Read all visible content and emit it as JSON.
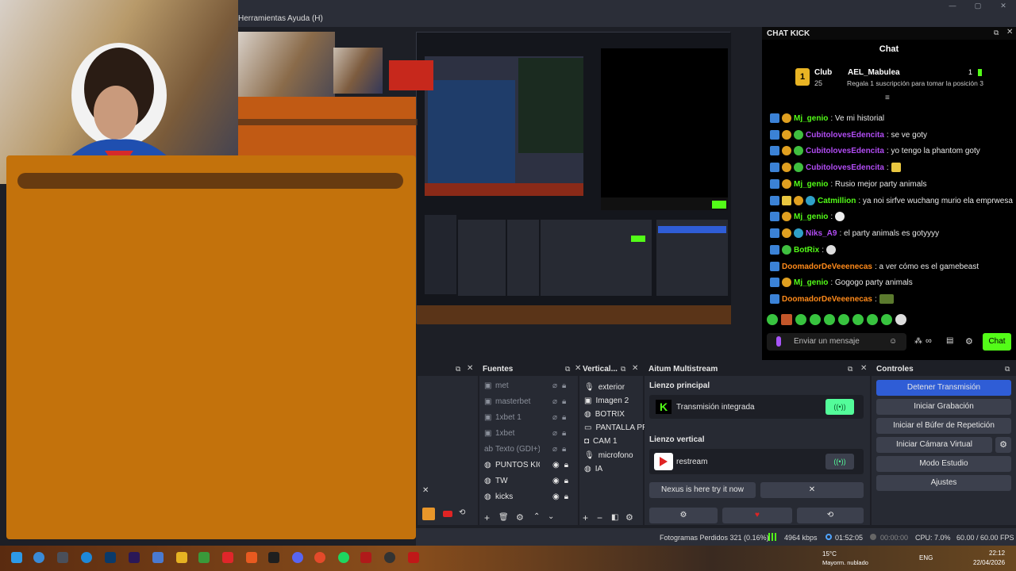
{
  "menu": {
    "herramientas": "Herramientas",
    "ayuda": "Ayuda (H)"
  },
  "window_controls": {
    "minimize": "—",
    "maximize": "▢",
    "close": "✕"
  },
  "chat": {
    "dock_title": "CHAT KICK",
    "header": "Chat",
    "club_label": "Club",
    "club_number": "25",
    "top_user": "AEL_Mabulea",
    "top_user_count": "1",
    "club_message": "Regala 1 suscripción para tomar la posición 3",
    "messages": [
      {
        "user": "Mj_genio",
        "text": "Ve mi historial",
        "color": "green"
      },
      {
        "user": "CubitolovesEdencita",
        "text": "se ve goty",
        "color": "purple"
      },
      {
        "user": "CubitolovesEdencita",
        "text": "yo tengo la phantom goty",
        "color": "purple"
      },
      {
        "user": "CubitolovesEdencita",
        "text": "",
        "color": "purple"
      },
      {
        "user": "Mj_genio",
        "text": "Rusio mejor party animals",
        "color": "green"
      },
      {
        "user": "Catmillion",
        "text": "ya noi sirfve wuchang murio ela emprwesa",
        "color": "green"
      },
      {
        "user": "Mj_genio",
        "text": "",
        "color": "green"
      },
      {
        "user": "Niks_A9",
        "text": "el party animals es gotyyyy",
        "color": "purple"
      },
      {
        "user": "BotRix",
        "text": "",
        "color": "green"
      },
      {
        "user": "DoomadorDeVeeenecas",
        "text": "a ver cómo es el gamebeast",
        "color": "orange"
      },
      {
        "user": "Mj_genio",
        "text": "Gogogo party animals",
        "color": "green"
      },
      {
        "user": "DoomadorDeVeeenecas",
        "text": "",
        "color": "orange"
      }
    ],
    "input_placeholder": "Enviar un mensaje",
    "send_label": "Chat"
  },
  "sources": {
    "title": "Fuentes",
    "items": [
      {
        "name": "met"
      },
      {
        "name": "masterbet"
      },
      {
        "name": "1xbet 1"
      },
      {
        "name": "1xbet"
      },
      {
        "name": "Texto (GDI+) 2"
      },
      {
        "name": "PUNTOS KICK"
      },
      {
        "name": "TW"
      },
      {
        "name": "kicks"
      }
    ]
  },
  "vertical": {
    "title": "Vertical...",
    "items": [
      {
        "name": "exterior"
      },
      {
        "name": "Imagen 2"
      },
      {
        "name": "BOTRIX"
      },
      {
        "name": "PANTALLA PR"
      },
      {
        "name": "CAM 1"
      },
      {
        "name": "microfono"
      },
      {
        "name": "IA"
      }
    ]
  },
  "multistream": {
    "title": "Aitum Multistream",
    "principal_label": "Lienzo principal",
    "principal_item": "Transmisión integrada",
    "vertical_label": "Lienzo vertical",
    "vertical_item": "restream",
    "nexus_label": "Nexus is here try it now"
  },
  "controls": {
    "title": "Controles",
    "buttons": [
      "Detener Transmisión",
      "Iniciar Grabación",
      "Iniciar el Búfer de Repetición",
      "Iniciar Cámara Virtual",
      "Modo Estudio",
      "Ajustes"
    ]
  },
  "status": {
    "dropped_frames": "Fotogramas Perdidos 321 (0.16%)",
    "bitrate": "4964 kbps",
    "stream_time": "01:52:05",
    "rec_time": "00:00:00",
    "cpu": "CPU: 7.0%",
    "fps": "60.00 / 60.00 FPS"
  },
  "taskbar": {
    "weather_temp": "15°C",
    "weather_desc": "Mayorm. nublado",
    "language": "ENG",
    "time": "22:12",
    "date": "22/04/2026"
  },
  "colors": {
    "kick_green": "#53fc18",
    "stream_active": "#2f5dd6",
    "overlay_orange": "#c3720c"
  }
}
